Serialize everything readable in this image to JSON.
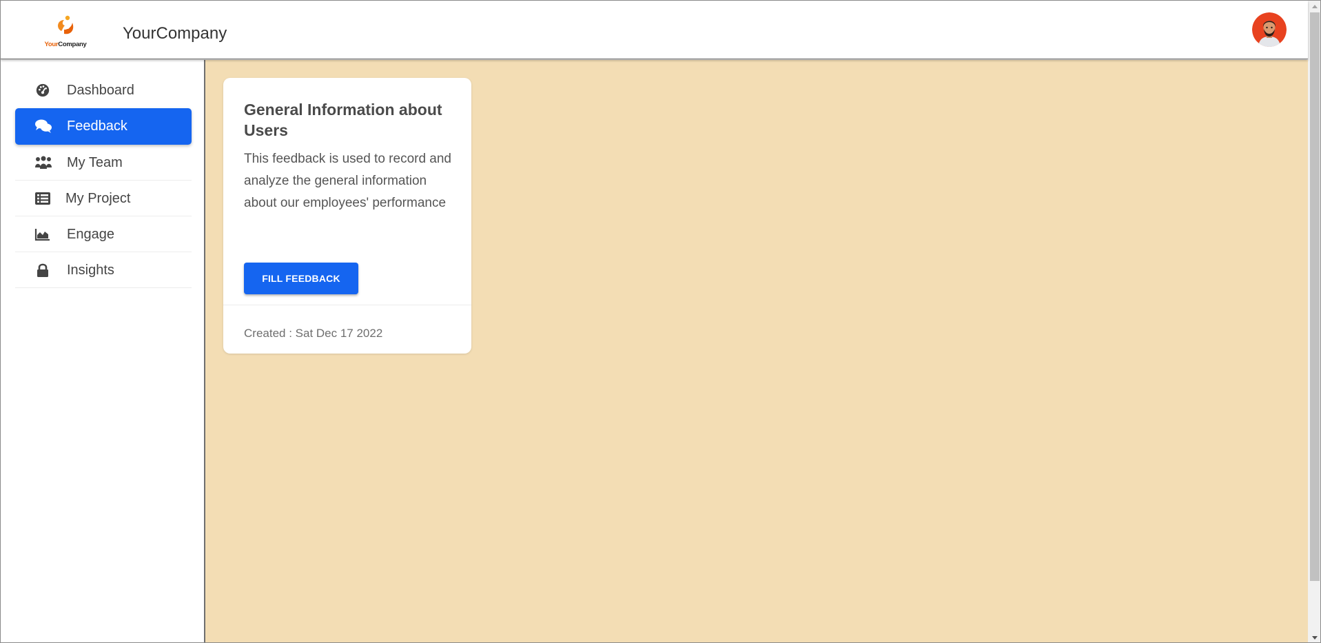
{
  "header": {
    "logo_text_your": "Your",
    "logo_text_company": "Company",
    "brand": "YourCompany"
  },
  "sidebar": {
    "items": [
      {
        "label": "Dashboard",
        "icon": "dashboard-gauge-icon",
        "active": false
      },
      {
        "label": "Feedback",
        "icon": "comments-icon",
        "active": true
      },
      {
        "label": "My Team",
        "icon": "team-icon",
        "active": false
      },
      {
        "label": "My Project",
        "icon": "list-icon",
        "active": false
      },
      {
        "label": "Engage",
        "icon": "area-chart-icon",
        "active": false
      },
      {
        "label": "Insights",
        "icon": "lock-icon",
        "active": false
      }
    ]
  },
  "main": {
    "card": {
      "title": "General Information about Users",
      "description": "This feedback is used to record and analyze the general information about our employees' performance",
      "button_label": "FILL FEEDBACK",
      "footer": "Created : Sat Dec 17 2022"
    }
  },
  "colors": {
    "accent": "#1565f0",
    "main_background": "#f3ddb4",
    "logo_orange": "#e8620a",
    "avatar_background": "#e8421f"
  }
}
